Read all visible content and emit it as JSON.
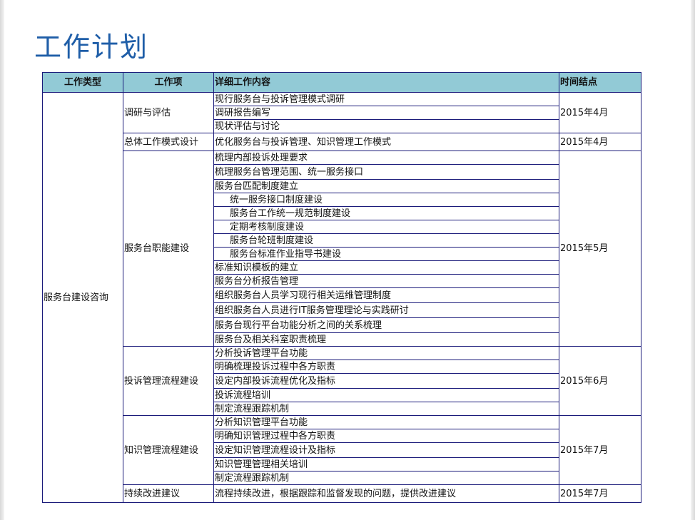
{
  "title": "工作计划",
  "headers": {
    "type": "工作类型",
    "item": "工作项",
    "detail": "详细工作内容",
    "time": "时间结点"
  },
  "type_value": "服务台建设咨询",
  "groups": {
    "g1": {
      "item": "调研与评估",
      "time": "2015年4月",
      "details": [
        "现行服务台与投诉管理模式调研",
        "调研报告编写",
        "现状评估与讨论"
      ]
    },
    "g2": {
      "item": "总体工作模式设计",
      "time": "2015年4月",
      "details": [
        "优化服务台与投诉管理、知识管理工作模式"
      ]
    },
    "g3": {
      "item": "服务台职能建设",
      "time": "2015年5月",
      "details": [
        "梳理内部投诉处理要求",
        "梳理服务台管理范围、统一服务接口",
        "服务台匹配制度建立",
        "统一服务接口制度建设",
        "服务台工作统一规范制度建设",
        "定期考核制度建设",
        "服务台轮班制度建设",
        "服务台标准作业指导书建设",
        "标准知识模板的建立",
        "服务台分析报告管理",
        "组织服务台人员学习现行相关运维管理制度",
        "组织服务台人员进行IT服务管理理论与实践研讨",
        "服务台现行平台功能分析之间的关系梳理",
        "服务台及相关科室职责梳理"
      ]
    },
    "g4": {
      "item": "投诉管理流程建设",
      "time": "2015年6月",
      "details": [
        "分析投诉管理平台功能",
        "明确梳理投诉过程中各方职责",
        "设定内部投诉流程优化及指标",
        "投诉流程培训",
        "制定流程跟踪机制"
      ]
    },
    "g5": {
      "item": "知识管理流程建设",
      "time": "2015年7月",
      "details": [
        "分析知识管理平台功能",
        "明确知识管理过程中各方职责",
        "设定知识管理流程设计及指标",
        "知识管理管理相关培训",
        "制定流程跟踪机制"
      ]
    },
    "g6": {
      "item": "持续改进建议",
      "time": "2015年7月",
      "details": [
        "流程持续改进，根据跟踪和监督发现的问题，提供改进建议"
      ]
    }
  }
}
